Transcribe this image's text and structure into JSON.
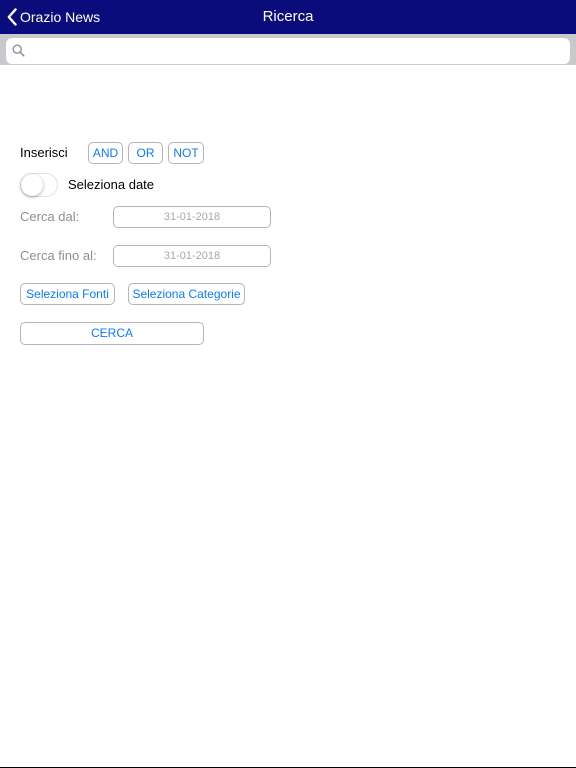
{
  "navbar": {
    "back_label": "Orazio News",
    "title": "Ricerca",
    "background": "#0b0c7c"
  },
  "search": {
    "placeholder": "",
    "value": "",
    "icon": "search-icon"
  },
  "operators": {
    "label": "Inserisci",
    "buttons": [
      "AND",
      "OR",
      "NOT"
    ]
  },
  "date_toggle": {
    "label": "Seleziona date",
    "on": false
  },
  "dates": {
    "from_label": "Cerca dal:",
    "from_value": "31-01-2018",
    "to_label": "Cerca fino al:",
    "to_value": "31-01-2018"
  },
  "filters": {
    "sources_label": "Seleziona Fonti",
    "categories_label": "Seleziona Categorie"
  },
  "submit_label": "CERCA",
  "colors": {
    "accent": "#0a7aff",
    "disabled_text": "#8e8e93"
  }
}
